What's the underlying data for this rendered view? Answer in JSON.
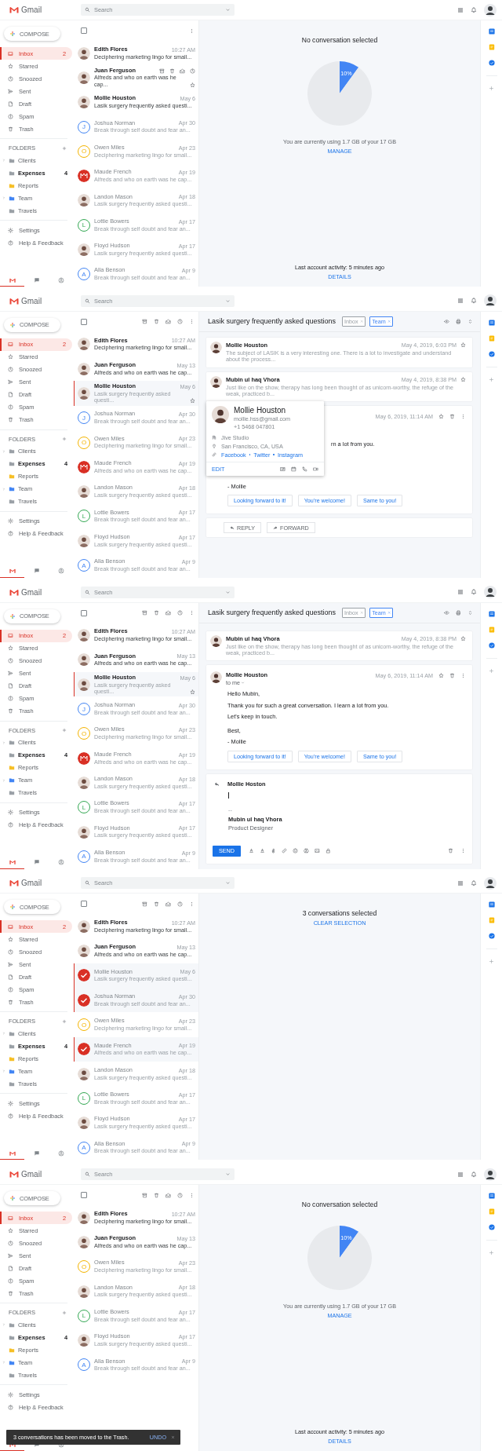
{
  "screens": [
    {
      "brand": "Gmail",
      "search": {
        "placeholder": "Search"
      },
      "compose": "COMPOSE",
      "nav": [
        {
          "label": "Inbox",
          "count": "2",
          "selected": true
        },
        {
          "label": "Starred",
          "selected": false
        },
        {
          "label": "Snoozed",
          "selected": false
        },
        {
          "label": "Sent",
          "selected": false
        },
        {
          "label": "Draft",
          "selected": false
        },
        {
          "label": "Spam",
          "selected": false
        },
        {
          "label": "Trash",
          "selected": false
        }
      ],
      "folders_title": "FOLDERS",
      "folders": [
        {
          "label": "Clients",
          "color": "#9aa0a6",
          "has_children": true,
          "unread": false
        },
        {
          "label": "Expenses",
          "color": "#9aa0a6",
          "has_children": false,
          "unread": true,
          "count": "4"
        },
        {
          "label": "Reports",
          "color": "#f6bf26",
          "has_children": false,
          "unread": false
        },
        {
          "label": "Team",
          "color": "#4285f4",
          "has_children": true,
          "unread": false
        },
        {
          "label": "Travels",
          "color": "#9aa0a6",
          "has_children": false,
          "unread": false
        }
      ],
      "links": [
        {
          "label": "Settings"
        },
        {
          "label": "Help & Feedback"
        }
      ],
      "bottom_tabs": [
        {
          "selected": true
        },
        {
          "selected": false
        },
        {
          "selected": false
        }
      ],
      "toolbar": {
        "all_checked": false,
        "bulk_actions": false
      },
      "mails": [
        {
          "sender": "Edith Flores",
          "snippet": "Deciphering marketing lingo for small...",
          "date": "10:27 AM",
          "unread": true,
          "selected": false,
          "checked": false,
          "hovered": false,
          "avatar": {
            "kind": "photo"
          }
        },
        {
          "sender": "Juan Ferguson",
          "snippet": "Alfreds and who on earth was he cap...",
          "unread": true,
          "selected": false,
          "checked": false,
          "hovered": true,
          "avatar": {
            "kind": "photo"
          }
        },
        {
          "sender": "Mollie Houston",
          "snippet": "Lasik surgery frequently asked questi...",
          "date": "May 6",
          "unread": true,
          "selected": false,
          "checked": false,
          "hovered": false,
          "avatar": {
            "kind": "photo"
          }
        },
        {
          "sender": "Joshua Norman",
          "snippet": "Break through self doubt and fear an...",
          "date": "Apr 30",
          "unread": false,
          "selected": false,
          "checked": false,
          "hovered": false,
          "avatar": {
            "kind": "letter",
            "letter": "J",
            "color": "#4285f4"
          }
        },
        {
          "sender": "Owen Miles",
          "snippet": "Deciphering marketing lingo for small...",
          "date": "Apr 23",
          "unread": false,
          "selected": false,
          "checked": false,
          "hovered": false,
          "avatar": {
            "kind": "letter",
            "letter": "O",
            "color": "#f4b400"
          }
        },
        {
          "sender": "Maude French",
          "snippet": "Alfreds and who on earth was he cap...",
          "date": "Apr 19",
          "unread": false,
          "selected": false,
          "checked": false,
          "hovered": false,
          "avatar": {
            "kind": "logo",
            "color": "#d93025"
          }
        },
        {
          "sender": "Landon Mason",
          "snippet": "Lasik surgery frequently asked questi...",
          "date": "Apr 18",
          "unread": false,
          "selected": false,
          "checked": false,
          "hovered": false,
          "avatar": {
            "kind": "photo"
          }
        },
        {
          "sender": "Lottie Bowers",
          "snippet": "Break through self doubt and fear an...",
          "date": "Apr 17",
          "unread": false,
          "selected": false,
          "checked": false,
          "hovered": false,
          "avatar": {
            "kind": "letter",
            "letter": "L",
            "color": "#34a853"
          }
        },
        {
          "sender": "Floyd Hudson",
          "snippet": "Lasik surgery frequently asked questi...",
          "date": "Apr 17",
          "unread": false,
          "selected": false,
          "checked": false,
          "hovered": false,
          "avatar": {
            "kind": "photo"
          }
        },
        {
          "sender": "Alla Benson",
          "snippet": "Break through self doubt and fear an...",
          "date": "Apr 9",
          "unread": false,
          "selected": false,
          "checked": false,
          "hovered": false,
          "avatar": {
            "kind": "letter",
            "letter": "A",
            "color": "#4285f4"
          }
        }
      ],
      "pane": {
        "kind": "empty",
        "title": "No conversation selected",
        "storage": {
          "chart_data": {
            "type": "pie",
            "values": [
              10,
              90
            ],
            "value_labels": [
              "10%",
              null
            ]
          }
        },
        "usage": "You are currently using 1.7 GB of your 17 GB",
        "manage": "MANAGE",
        "activity": "Last account activity: 5 minutes ago",
        "details": "DETAILS"
      }
    },
    {
      "brand": "Gmail",
      "search": {
        "placeholder": "Search"
      },
      "compose": "COMPOSE",
      "nav": [
        {
          "label": "Inbox",
          "count": "2",
          "selected": true
        },
        {
          "label": "Starred",
          "selected": false
        },
        {
          "label": "Snoozed",
          "selected": false
        },
        {
          "label": "Sent",
          "selected": false
        },
        {
          "label": "Draft",
          "selected": false
        },
        {
          "label": "Spam",
          "selected": false
        },
        {
          "label": "Trash",
          "selected": false
        }
      ],
      "folders_title": "FOLDERS",
      "folders": [
        {
          "label": "Clients",
          "color": "#9aa0a6",
          "has_children": true,
          "unread": false
        },
        {
          "label": "Expenses",
          "color": "#9aa0a6",
          "has_children": false,
          "unread": true,
          "count": "4"
        },
        {
          "label": "Reports",
          "color": "#f6bf26",
          "has_children": false,
          "unread": false
        },
        {
          "label": "Team",
          "color": "#4285f4",
          "has_children": true,
          "unread": false
        },
        {
          "label": "Travels",
          "color": "#9aa0a6",
          "has_children": false,
          "unread": false
        }
      ],
      "links": [
        {
          "label": "Settings"
        },
        {
          "label": "Help & Feedback"
        }
      ],
      "bottom_tabs": [
        {
          "selected": true
        },
        {
          "selected": false
        },
        {
          "selected": false
        }
      ],
      "toolbar": {
        "all_checked": false,
        "bulk_actions": true
      },
      "mails": [
        {
          "sender": "Edith Flores",
          "snippet": "Deciphering marketing lingo for small...",
          "date": "10:27 AM",
          "unread": true,
          "selected": false,
          "checked": false,
          "hovered": false,
          "avatar": {
            "kind": "photo"
          }
        },
        {
          "sender": "Juan Ferguson",
          "snippet": "Alfreds and who on earth was he cap...",
          "date": "May 13",
          "unread": true,
          "selected": false,
          "checked": false,
          "hovered": false,
          "avatar": {
            "kind": "photo"
          }
        },
        {
          "sender": "Mollie Houston",
          "snippet": "Lasik surgery frequently asked questi...",
          "date": "May 6",
          "unread": false,
          "selected": true,
          "checked": false,
          "hovered": false,
          "avatar": {
            "kind": "photo"
          }
        },
        {
          "sender": "Joshua Norman",
          "snippet": "Break through self doubt and fear an...",
          "date": "Apr 30",
          "unread": false,
          "selected": false,
          "checked": false,
          "hovered": false,
          "avatar": {
            "kind": "letter",
            "letter": "J",
            "color": "#4285f4"
          }
        },
        {
          "sender": "Owen Miles",
          "snippet": "Deciphering marketing lingo for small...",
          "date": "Apr 23",
          "unread": false,
          "selected": false,
          "checked": false,
          "hovered": false,
          "avatar": {
            "kind": "letter",
            "letter": "O",
            "color": "#f4b400"
          }
        },
        {
          "sender": "Maude French",
          "snippet": "Alfreds and who on earth was he cap...",
          "date": "Apr 19",
          "unread": false,
          "selected": false,
          "checked": false,
          "hovered": false,
          "avatar": {
            "kind": "logo",
            "color": "#d93025"
          }
        },
        {
          "sender": "Landon Mason",
          "snippet": "Lasik surgery frequently asked questi...",
          "date": "Apr 18",
          "unread": false,
          "selected": false,
          "checked": false,
          "hovered": false,
          "avatar": {
            "kind": "photo"
          }
        },
        {
          "sender": "Lottie Bowers",
          "snippet": "Break through self doubt and fear an...",
          "date": "Apr 17",
          "unread": false,
          "selected": false,
          "checked": false,
          "hovered": false,
          "avatar": {
            "kind": "letter",
            "letter": "L",
            "color": "#34a853"
          }
        },
        {
          "sender": "Floyd Hudson",
          "snippet": "Lasik surgery frequently asked questi...",
          "date": "Apr 17",
          "unread": false,
          "selected": false,
          "checked": false,
          "hovered": false,
          "avatar": {
            "kind": "photo"
          }
        },
        {
          "sender": "Alla Benson",
          "snippet": "Break through self doubt and fear an...",
          "date": "Apr 9",
          "unread": false,
          "selected": false,
          "checked": false,
          "hovered": false,
          "avatar": {
            "kind": "letter",
            "letter": "A",
            "color": "#4285f4"
          }
        }
      ],
      "pane": {
        "kind": "thread",
        "subject": "Lasik surgery frequently asked questions",
        "tags": [
          {
            "label": "Inbox",
            "color": "#9aa0a6"
          },
          {
            "label": "Team",
            "color": "#4285f4"
          }
        ],
        "messages": [
          {
            "kind": "collapsed",
            "sender": "Mollie Houston",
            "snippet": "The subject of LASIK is a very interesting one. There is a lot to investigate and understand about the process...",
            "date": "May 4, 2019, 6:03 PM"
          },
          {
            "kind": "collapsed",
            "sender": "Mubin ul haq Vhora",
            "snippet": "Just like on the show, therapy has long been thought of as unicorn-worthy, the refuge of the weak, practiced b...",
            "date": "May 4, 2019, 8:38 PM"
          },
          {
            "kind": "partial",
            "date": "May 6, 2019, 11:14 AM",
            "fragment": "rn a lot from you.",
            "signoff": "- Mollie",
            "smart_replies": [
              "Looking forward to it!",
              "You're welcome!",
              "Same to you!"
            ]
          }
        ],
        "actions": {
          "reply": "REPLY",
          "forward": "FORWARD"
        },
        "contact_card": {
          "name": "Mollie Houston",
          "email": "mollie.hss@gmail.com",
          "phone": "+1 5468 047801",
          "company": "Jive Studio",
          "location": "San Francisco, CA, USA",
          "links": [
            "Facebook",
            "Twitter",
            "Instagram"
          ],
          "edit": "EDIT"
        }
      }
    },
    {
      "brand": "Gmail",
      "search": {
        "placeholder": "Search"
      },
      "compose": "COMPOSE",
      "nav": [
        {
          "label": "Inbox",
          "count": "2",
          "selected": true
        },
        {
          "label": "Starred",
          "selected": false
        },
        {
          "label": "Snoozed",
          "selected": false
        },
        {
          "label": "Sent",
          "selected": false
        },
        {
          "label": "Draft",
          "selected": false
        },
        {
          "label": "Spam",
          "selected": false
        },
        {
          "label": "Trash",
          "selected": false
        }
      ],
      "folders_title": "FOLDERS",
      "folders": [
        {
          "label": "Clients",
          "color": "#9aa0a6",
          "has_children": true,
          "unread": false
        },
        {
          "label": "Expenses",
          "color": "#9aa0a6",
          "has_children": false,
          "unread": true,
          "count": "4"
        },
        {
          "label": "Reports",
          "color": "#f6bf26",
          "has_children": false,
          "unread": false
        },
        {
          "label": "Team",
          "color": "#4285f4",
          "has_children": true,
          "unread": false
        },
        {
          "label": "Travels",
          "color": "#9aa0a6",
          "has_children": false,
          "unread": false
        }
      ],
      "links": [
        {
          "label": "Settings"
        },
        {
          "label": "Help & Feedback"
        }
      ],
      "bottom_tabs": [
        {
          "selected": true
        },
        {
          "selected": false
        },
        {
          "selected": false
        }
      ],
      "toolbar": {
        "all_checked": false,
        "bulk_actions": true
      },
      "mails": [
        {
          "sender": "Edith Flores",
          "snippet": "Deciphering marketing lingo for small...",
          "date": "10:27 AM",
          "unread": true,
          "selected": false,
          "checked": false,
          "hovered": false,
          "avatar": {
            "kind": "photo"
          }
        },
        {
          "sender": "Juan Ferguson",
          "snippet": "Alfreds and who on earth was he cap...",
          "date": "May 13",
          "unread": true,
          "selected": false,
          "checked": false,
          "hovered": false,
          "avatar": {
            "kind": "photo"
          }
        },
        {
          "sender": "Mollie Houston",
          "snippet": "Lasik surgery frequently asked questi...",
          "date": "May 6",
          "unread": false,
          "selected": true,
          "checked": false,
          "hovered": false,
          "avatar": {
            "kind": "photo"
          }
        },
        {
          "sender": "Joshua Norman",
          "snippet": "Break through self doubt and fear an...",
          "date": "Apr 30",
          "unread": false,
          "selected": false,
          "checked": false,
          "hovered": false,
          "avatar": {
            "kind": "letter",
            "letter": "J",
            "color": "#4285f4"
          }
        },
        {
          "sender": "Owen Miles",
          "snippet": "Deciphering marketing lingo for small...",
          "date": "Apr 23",
          "unread": false,
          "selected": false,
          "checked": false,
          "hovered": false,
          "avatar": {
            "kind": "letter",
            "letter": "O",
            "color": "#f4b400"
          }
        },
        {
          "sender": "Maude French",
          "snippet": "Alfreds and who on earth was he cap...",
          "date": "Apr 19",
          "unread": false,
          "selected": false,
          "checked": false,
          "hovered": false,
          "avatar": {
            "kind": "logo",
            "color": "#d93025"
          }
        },
        {
          "sender": "Landon Mason",
          "snippet": "Lasik surgery frequently asked questi...",
          "date": "Apr 18",
          "unread": false,
          "selected": false,
          "checked": false,
          "hovered": false,
          "avatar": {
            "kind": "photo"
          }
        },
        {
          "sender": "Lottie Bowers",
          "snippet": "Break through self doubt and fear an...",
          "date": "Apr 17",
          "unread": false,
          "selected": false,
          "checked": false,
          "hovered": false,
          "avatar": {
            "kind": "letter",
            "letter": "L",
            "color": "#34a853"
          }
        },
        {
          "sender": "Floyd Hudson",
          "snippet": "Lasik surgery frequently asked questi...",
          "date": "Apr 17",
          "unread": false,
          "selected": false,
          "checked": false,
          "hovered": false,
          "avatar": {
            "kind": "photo"
          }
        },
        {
          "sender": "Alla Benson",
          "snippet": "Break through self doubt and fear an...",
          "date": "Apr 9",
          "unread": false,
          "selected": false,
          "checked": false,
          "hovered": false,
          "avatar": {
            "kind": "letter",
            "letter": "A",
            "color": "#4285f4"
          }
        }
      ],
      "pane": {
        "kind": "thread",
        "subject": "Lasik surgery frequently asked questions",
        "tags": [
          {
            "label": "Inbox",
            "color": "#9aa0a6"
          },
          {
            "label": "Team",
            "color": "#4285f4"
          }
        ],
        "messages": [
          {
            "kind": "collapsed",
            "sender": "Mubin ul haq Vhora",
            "snippet": "Just like on the show, therapy has long been thought of as unicorn-worthy, the refuge of the weak, practiced b...",
            "date": "May 4, 2019, 8:38 PM"
          },
          {
            "kind": "expanded",
            "sender": "Mollie Houston",
            "recipient": "to me",
            "date": "May 6, 2019, 11:14 AM",
            "body": [
              "Hello Mubin,",
              "Thank you for such a great conversation. I learn a lot from you.",
              "Let's keep in touch."
            ],
            "closing": [
              "Best,",
              "- Mollie"
            ],
            "smart_replies": [
              "Looking forward to it!",
              "You're welcome!",
              "Same to you!"
            ]
          }
        ],
        "composer": {
          "to": "Mollie Hoston",
          "rule": "--",
          "signature_name": "Mubin ul haq Vhora",
          "signature_title": "Product Designer",
          "send": "SEND"
        }
      }
    },
    {
      "brand": "Gmail",
      "search": {
        "placeholder": "Search"
      },
      "compose": "COMPOSE",
      "nav": [
        {
          "label": "Inbox",
          "count": "2",
          "selected": true
        },
        {
          "label": "Starred",
          "selected": false
        },
        {
          "label": "Snoozed",
          "selected": false
        },
        {
          "label": "Sent",
          "selected": false
        },
        {
          "label": "Draft",
          "selected": false
        },
        {
          "label": "Spam",
          "selected": false
        },
        {
          "label": "Trash",
          "selected": false
        }
      ],
      "folders_title": "FOLDERS",
      "folders": [
        {
          "label": "Clients",
          "color": "#9aa0a6",
          "has_children": true,
          "unread": false
        },
        {
          "label": "Expenses",
          "color": "#9aa0a6",
          "has_children": false,
          "unread": true,
          "count": "4"
        },
        {
          "label": "Reports",
          "color": "#f6bf26",
          "has_children": false,
          "unread": false
        },
        {
          "label": "Team",
          "color": "#4285f4",
          "has_children": true,
          "unread": false
        },
        {
          "label": "Travels",
          "color": "#9aa0a6",
          "has_children": false,
          "unread": false
        }
      ],
      "links": [
        {
          "label": "Settings"
        },
        {
          "label": "Help & Feedback"
        }
      ],
      "bottom_tabs": [
        {
          "selected": true
        },
        {
          "selected": false
        },
        {
          "selected": false
        }
      ],
      "toolbar": {
        "all_checked": false,
        "bulk_actions": true
      },
      "mails": [
        {
          "sender": "Edith Flores",
          "snippet": "Deciphering marketing lingo for small...",
          "date": "10:27 AM",
          "unread": true,
          "selected": false,
          "checked": false,
          "hovered": false,
          "avatar": {
            "kind": "photo"
          }
        },
        {
          "sender": "Juan Ferguson",
          "snippet": "Alfreds and who on earth was he cap...",
          "date": "May 13",
          "unread": true,
          "selected": false,
          "checked": false,
          "hovered": false,
          "avatar": {
            "kind": "photo"
          }
        },
        {
          "sender": "Mollie Houston",
          "snippet": "Lasik surgery frequently asked questi...",
          "date": "May 6",
          "unread": false,
          "selected": false,
          "checked": true,
          "hovered": false
        },
        {
          "sender": "Joshua Norman",
          "snippet": "Break through self doubt and fear an...",
          "date": "Apr 30",
          "unread": false,
          "selected": false,
          "checked": true,
          "hovered": false
        },
        {
          "sender": "Owen Miles",
          "snippet": "Deciphering marketing lingo for small...",
          "date": "Apr 23",
          "unread": false,
          "selected": false,
          "checked": false,
          "hovered": false,
          "avatar": {
            "kind": "letter",
            "letter": "O",
            "color": "#f4b400"
          }
        },
        {
          "sender": "Maude French",
          "snippet": "Alfreds and who on earth was he cap...",
          "date": "Apr 19",
          "unread": false,
          "selected": false,
          "checked": true,
          "hovered": false
        },
        {
          "sender": "Landon Mason",
          "snippet": "Lasik surgery frequently asked questi...",
          "date": "Apr 18",
          "unread": false,
          "selected": false,
          "checked": false,
          "hovered": false,
          "avatar": {
            "kind": "photo"
          }
        },
        {
          "sender": "Lottie Bowers",
          "snippet": "Break through self doubt and fear an...",
          "date": "Apr 17",
          "unread": false,
          "selected": false,
          "checked": false,
          "hovered": false,
          "avatar": {
            "kind": "letter",
            "letter": "L",
            "color": "#34a853"
          }
        },
        {
          "sender": "Floyd Hudson",
          "snippet": "Lasik surgery frequently asked questi...",
          "date": "Apr 17",
          "unread": false,
          "selected": false,
          "checked": false,
          "hovered": false,
          "avatar": {
            "kind": "photo"
          }
        },
        {
          "sender": "Alla Benson",
          "snippet": "Break through self doubt and fear an...",
          "date": "Apr 9",
          "unread": false,
          "selected": false,
          "checked": false,
          "hovered": false,
          "avatar": {
            "kind": "letter",
            "letter": "A",
            "color": "#4285f4"
          }
        }
      ],
      "pane": {
        "kind": "selection",
        "title": "3 conversations selected",
        "action": "CLEAR SELECTION"
      }
    },
    {
      "brand": "Gmail",
      "search": {
        "placeholder": "Search"
      },
      "compose": "COMPOSE",
      "nav": [
        {
          "label": "Inbox",
          "count": "2",
          "selected": true
        },
        {
          "label": "Starred",
          "selected": false
        },
        {
          "label": "Snoozed",
          "selected": false
        },
        {
          "label": "Sent",
          "selected": false
        },
        {
          "label": "Draft",
          "selected": false
        },
        {
          "label": "Spam",
          "selected": false
        },
        {
          "label": "Trash",
          "selected": false
        }
      ],
      "folders_title": "FOLDERS",
      "folders": [
        {
          "label": "Clients",
          "color": "#9aa0a6",
          "has_children": true,
          "unread": false
        },
        {
          "label": "Expenses",
          "color": "#9aa0a6",
          "has_children": false,
          "unread": true,
          "count": "4"
        },
        {
          "label": "Reports",
          "color": "#f6bf26",
          "has_children": false,
          "unread": false
        },
        {
          "label": "Team",
          "color": "#4285f4",
          "has_children": true,
          "unread": false
        },
        {
          "label": "Travels",
          "color": "#9aa0a6",
          "has_children": false,
          "unread": false
        }
      ],
      "links": [
        {
          "label": "Settings"
        },
        {
          "label": "Help & Feedback"
        }
      ],
      "bottom_tabs": [
        {
          "selected": true
        },
        {
          "selected": false
        },
        {
          "selected": false
        }
      ],
      "toolbar": {
        "all_checked": false,
        "bulk_actions": true
      },
      "mails": [
        {
          "sender": "Edith Flores",
          "snippet": "Deciphering marketing lingo for small...",
          "date": "10:27 AM",
          "unread": true,
          "selected": false,
          "checked": false,
          "hovered": false,
          "avatar": {
            "kind": "photo"
          }
        },
        {
          "sender": "Juan Ferguson",
          "snippet": "Alfreds and who on earth was he cap...",
          "date": "May 13",
          "unread": true,
          "selected": false,
          "checked": false,
          "hovered": false,
          "avatar": {
            "kind": "photo"
          }
        },
        {
          "sender": "Owen Miles",
          "snippet": "Deciphering marketing lingo for small...",
          "date": "Apr 23",
          "unread": false,
          "selected": false,
          "checked": false,
          "hovered": false,
          "avatar": {
            "kind": "letter",
            "letter": "O",
            "color": "#f4b400"
          }
        },
        {
          "sender": "Landon Mason",
          "snippet": "Lasik surgery frequently asked questi...",
          "date": "Apr 18",
          "unread": false,
          "selected": false,
          "checked": false,
          "hovered": false,
          "avatar": {
            "kind": "photo"
          }
        },
        {
          "sender": "Lottie Bowers",
          "snippet": "Break through self doubt and fear an...",
          "date": "Apr 17",
          "unread": false,
          "selected": false,
          "checked": false,
          "hovered": false,
          "avatar": {
            "kind": "letter",
            "letter": "L",
            "color": "#34a853"
          }
        },
        {
          "sender": "Floyd Hudson",
          "snippet": "Lasik surgery frequently asked questi...",
          "date": "Apr 17",
          "unread": false,
          "selected": false,
          "checked": false,
          "hovered": false,
          "avatar": {
            "kind": "photo"
          }
        },
        {
          "sender": "Alla Benson",
          "snippet": "Break through self doubt and fear an...",
          "date": "Apr 9",
          "unread": false,
          "selected": false,
          "checked": false,
          "hovered": false,
          "avatar": {
            "kind": "letter",
            "letter": "A",
            "color": "#4285f4"
          }
        }
      ],
      "pane": {
        "kind": "empty",
        "title": "No conversation selected",
        "storage": {
          "chart_data": {
            "type": "pie",
            "values": [
              10,
              90
            ],
            "value_labels": [
              "10%",
              null
            ]
          }
        },
        "usage": "You are currently using 1.7 GB of your 17 GB",
        "manage": "MANAGE",
        "activity": "Last account activity: 5 minutes ago",
        "details": "DETAILS"
      },
      "toast": {
        "message": "3 conversations has been moved to the Trash.",
        "action": "UNDO"
      }
    }
  ]
}
